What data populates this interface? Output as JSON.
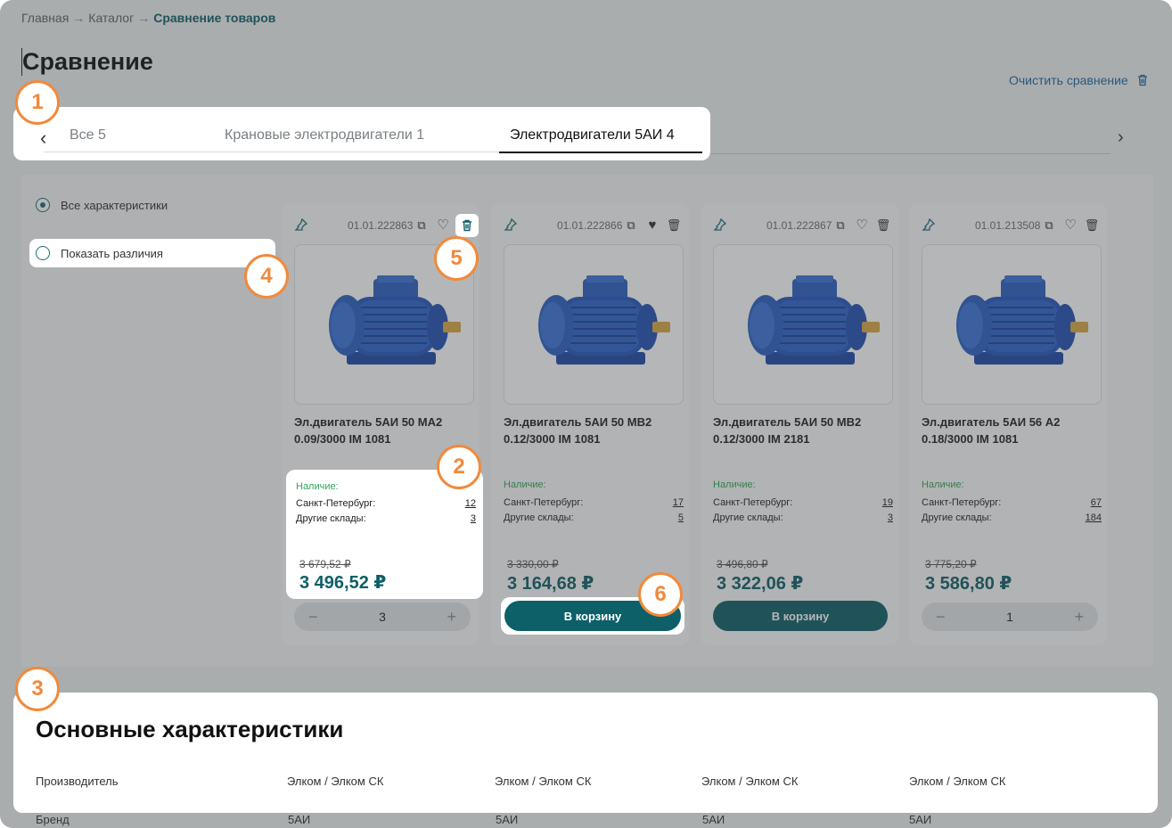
{
  "breadcrumb": {
    "items": [
      "Главная",
      "Каталог"
    ],
    "current": "Сравнение товаров",
    "separator": "→"
  },
  "page": {
    "title": "Сравнение",
    "clear_label": "Очистить сравнение"
  },
  "tabs": [
    {
      "label": "Все 5",
      "active": false
    },
    {
      "label": "Крановые электродвигатели 1",
      "active": false
    },
    {
      "label": "Электродвигатели 5АИ 4",
      "active": true
    }
  ],
  "filters": {
    "all": "Все характеристики",
    "diff": "Показать различия"
  },
  "labels": {
    "availability": "Наличие:",
    "spb": "Санкт-Петербург:",
    "other": "Другие склады:",
    "cart": "В корзину"
  },
  "products": [
    {
      "sku": "01.01.222863",
      "name": "Эл.двигатель 5АИ 50 МА2 0.09/3000 IM 1081",
      "spb": "12",
      "other": "3",
      "old_price": "3 679,52 ₽",
      "price": "3 496,52 ₽",
      "action": "stepper",
      "qty": "3"
    },
    {
      "sku": "01.01.222866",
      "name": "Эл.двигатель 5АИ 50 МВ2 0.12/3000 IM 1081",
      "spb": "17",
      "other": "5",
      "old_price": "3 330,00 ₽",
      "price": "3 164,68 ₽",
      "action": "cart"
    },
    {
      "sku": "01.01.222867",
      "name": "Эл.двигатель 5АИ 50 МВ2 0.12/3000 IM 2181",
      "spb": "19",
      "other": "3",
      "old_price": "3 496,80 ₽",
      "price": "3 322,06 ₽",
      "action": "cart"
    },
    {
      "sku": "01.01.213508",
      "name": "Эл.двигатель 5АИ 56 А2 0.18/3000 IM 1081",
      "spb": "67",
      "other": "184",
      "old_price": "3 775,20 ₽",
      "price": "3 586,80 ₽",
      "action": "stepper",
      "qty": "1"
    }
  ],
  "specs": {
    "title": "Основные характеристики",
    "rows": [
      {
        "label": "Производитель",
        "values": [
          "Элком / Элком СК",
          "Элком / Элком СК",
          "Элком / Элком СК",
          "Элком / Элком СК"
        ]
      },
      {
        "label": "Бренд",
        "values": [
          "5АИ",
          "5АИ",
          "5АИ",
          "5АИ"
        ]
      }
    ]
  },
  "badges": [
    "1",
    "2",
    "3",
    "4",
    "5",
    "6"
  ],
  "colors": {
    "accent": "#0d5f68",
    "badge": "#f08a3c",
    "available": "#2fa65a"
  }
}
